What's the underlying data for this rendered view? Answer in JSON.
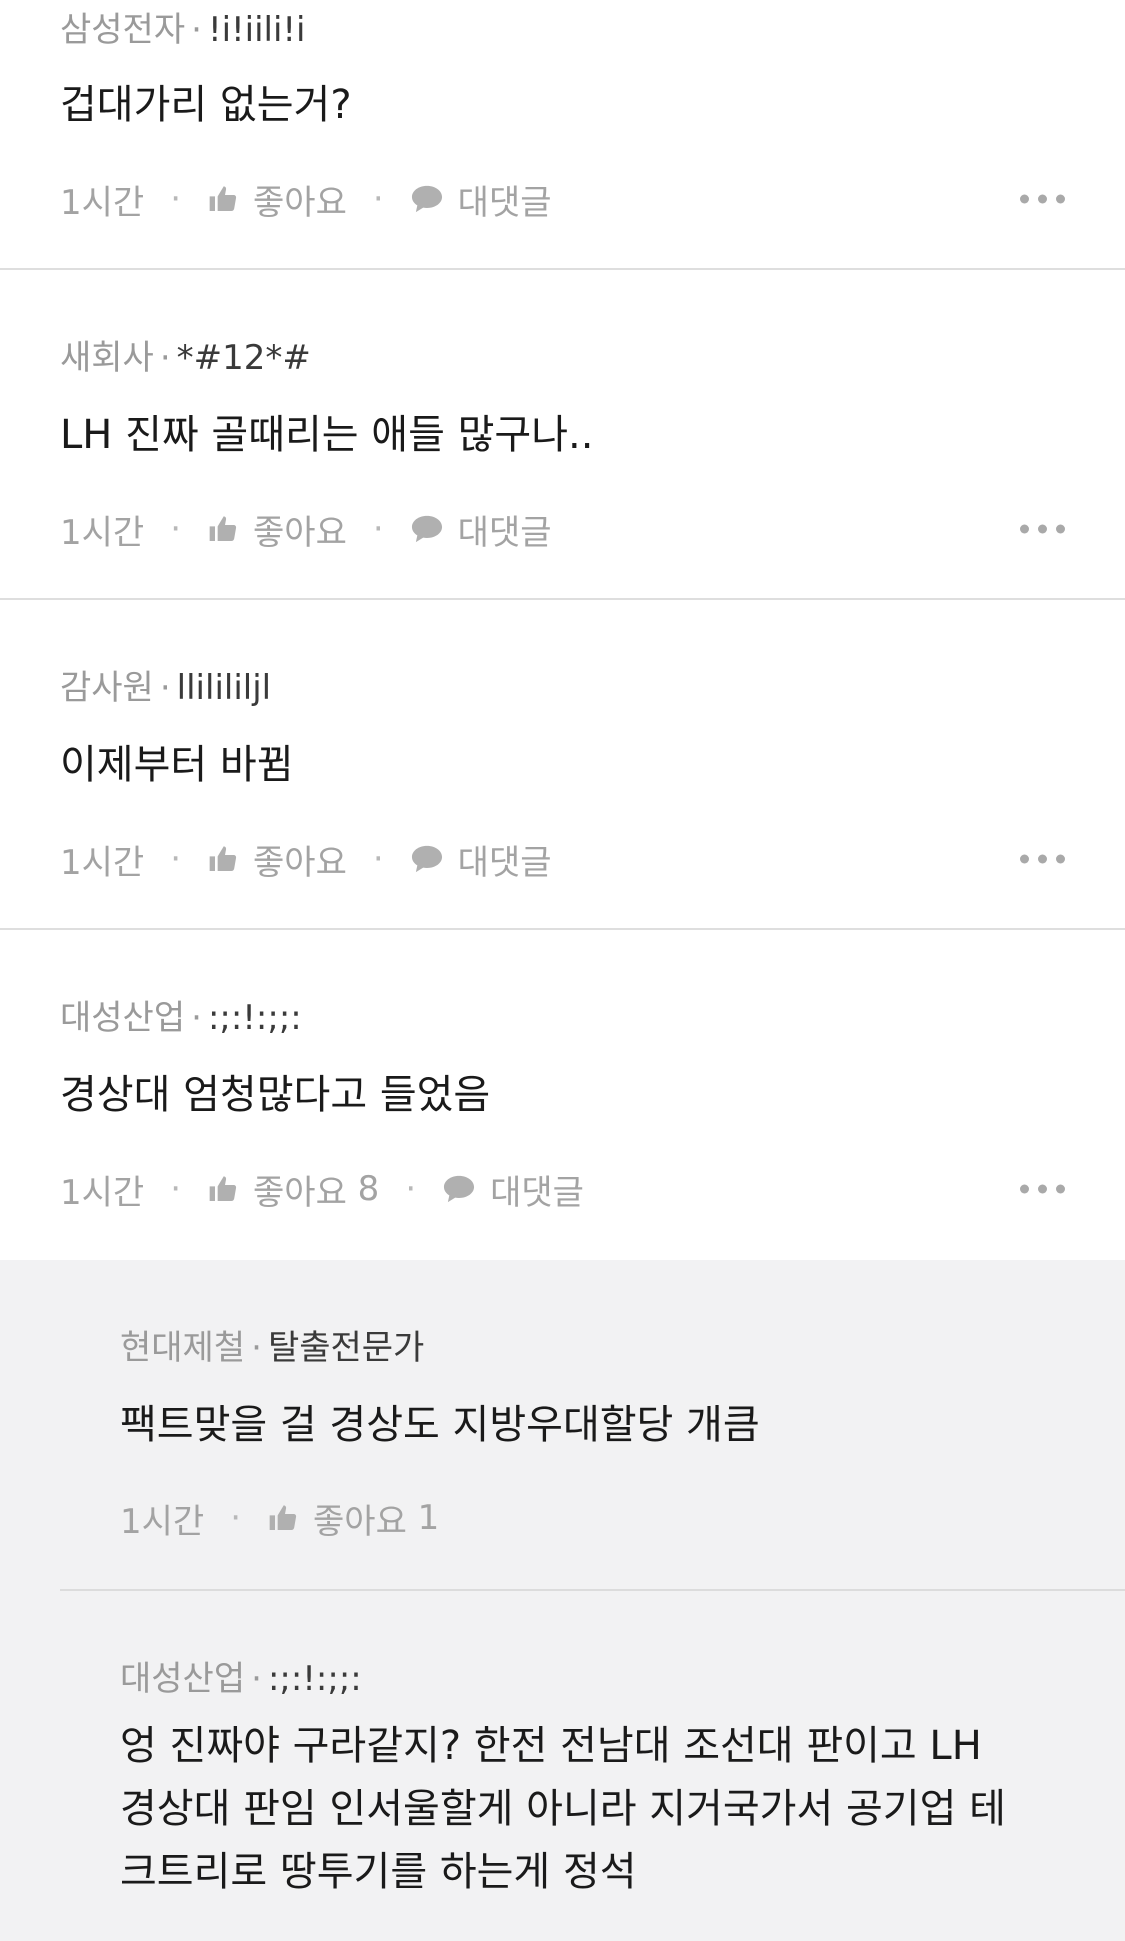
{
  "comments": [
    {
      "company": "삼성전자",
      "nickname": "!i!iili!i",
      "text": "겁대가리 없는거?",
      "time": "1시간",
      "like_label": "좋아요",
      "like_count": "",
      "reply_label": "대댓글"
    },
    {
      "company": "새회사",
      "nickname": "*#12*#",
      "text": "LH 진짜 골때리는 애들 많구나..",
      "time": "1시간",
      "like_label": "좋아요",
      "like_count": "",
      "reply_label": "대댓글"
    },
    {
      "company": "감사원",
      "nickname": "llilililjl",
      "text": "이제부터 바뀜",
      "time": "1시간",
      "like_label": "좋아요",
      "like_count": "",
      "reply_label": "대댓글"
    },
    {
      "company": "대성산업",
      "nickname": ":;:!:;;:",
      "text": "경상대 엄청많다고 들었음",
      "time": "1시간",
      "like_label": "좋아요",
      "like_count": "8",
      "reply_label": "대댓글"
    }
  ],
  "replies": [
    {
      "company": "현대제철",
      "nickname": "탈출전문가",
      "text": "팩트맞을 걸 경상도 지방우대할당 개큼",
      "time": "1시간",
      "like_label": "좋아요",
      "like_count": "1"
    },
    {
      "company": "대성산업",
      "nickname": ":;:!:;;:",
      "text_lines": [
        "엉 진짜야 구라같지? 한전 전남대 조선대 판이고 LH",
        "경상대 판임 인서울할게 아니라 지거국가서 공기업 테",
        "크트리로 땅투기를 하는게 정석"
      ]
    }
  ],
  "icons": {
    "like": "thumbs-up-icon",
    "reply": "speech-bubble-icon",
    "more": "more-dots-icon"
  },
  "colors": {
    "meta_gray": "#9a9a9a",
    "nickname": "#3a3a3a",
    "body_text": "#1a1a1a",
    "reply_background": "#f2f2f3",
    "divider": "#dedede"
  }
}
